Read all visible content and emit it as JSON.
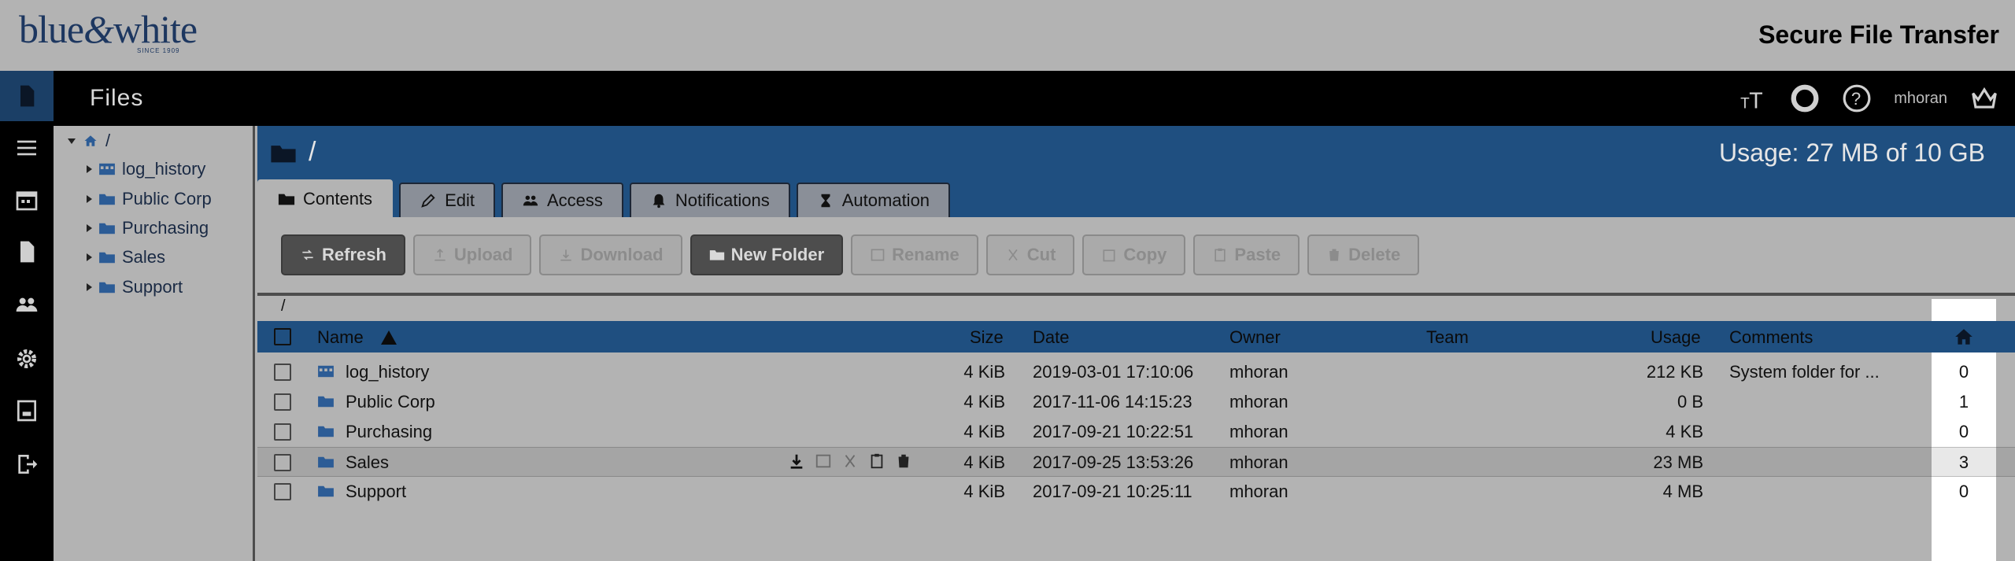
{
  "brand": {
    "logo_text_left": "blue",
    "logo_amp": "&",
    "logo_text_right": "white",
    "logo_since": "SINCE 1909",
    "app_title": "Secure File Transfer"
  },
  "rail": {
    "items": [
      {
        "icon": "files-icon",
        "active": true
      },
      {
        "icon": "menu-icon",
        "active": false
      },
      {
        "icon": "calendar-icon",
        "active": false
      },
      {
        "icon": "document-icon",
        "active": false
      },
      {
        "icon": "users-icon",
        "active": false
      },
      {
        "icon": "gear-icon",
        "active": false
      },
      {
        "icon": "report-icon",
        "active": false
      },
      {
        "icon": "logout-icon",
        "active": false
      }
    ]
  },
  "header": {
    "title": "Files",
    "username": "mhoran",
    "tools": [
      "text-size-icon",
      "help-ring-icon",
      "help-icon",
      "crown-icon"
    ]
  },
  "tree": {
    "root": "/",
    "items": [
      {
        "label": "log_history",
        "type": "system"
      },
      {
        "label": "Public Corp",
        "type": "folder"
      },
      {
        "label": "Purchasing",
        "type": "folder"
      },
      {
        "label": "Sales",
        "type": "folder"
      },
      {
        "label": "Support",
        "type": "folder"
      }
    ]
  },
  "main": {
    "path": "/",
    "usage": "Usage: 27 MB of 10 GB",
    "tabs": [
      {
        "label": "Contents",
        "active": true
      },
      {
        "label": "Edit",
        "active": false
      },
      {
        "label": "Access",
        "active": false
      },
      {
        "label": "Notifications",
        "active": false
      },
      {
        "label": "Automation",
        "active": false
      }
    ],
    "toolbar": [
      {
        "label": "Refresh",
        "enabled": true
      },
      {
        "label": "Upload",
        "enabled": false
      },
      {
        "label": "Download",
        "enabled": false
      },
      {
        "label": "New Folder",
        "enabled": true
      },
      {
        "label": "Rename",
        "enabled": false
      },
      {
        "label": "Cut",
        "enabled": false
      },
      {
        "label": "Copy",
        "enabled": false
      },
      {
        "label": "Paste",
        "enabled": false
      },
      {
        "label": "Delete",
        "enabled": false
      }
    ],
    "crumb": "/"
  },
  "table": {
    "headers": {
      "name": "Name",
      "size": "Size",
      "date": "Date",
      "owner": "Owner",
      "team": "Team",
      "usage": "Usage",
      "comments": "Comments"
    },
    "rows": [
      {
        "name": "log_history",
        "type": "system",
        "size": "4 KiB",
        "date": "2019-03-01 17:10:06",
        "owner": "mhoran",
        "team": "",
        "usage": "212 KB",
        "comments": "System folder for ...",
        "home": "0",
        "selected": false
      },
      {
        "name": "Public Corp",
        "type": "folder",
        "size": "4 KiB",
        "date": "2017-11-06 14:15:23",
        "owner": "mhoran",
        "team": "",
        "usage": "0 B",
        "comments": "",
        "home": "1",
        "selected": false
      },
      {
        "name": "Purchasing",
        "type": "folder",
        "size": "4 KiB",
        "date": "2017-09-21 10:22:51",
        "owner": "mhoran",
        "team": "",
        "usage": "4 KB",
        "comments": "",
        "home": "0",
        "selected": false
      },
      {
        "name": "Sales",
        "type": "folder",
        "size": "4 KiB",
        "date": "2017-09-25 13:53:26",
        "owner": "mhoran",
        "team": "",
        "usage": "23 MB",
        "comments": "",
        "home": "3",
        "selected": true
      },
      {
        "name": "Support",
        "type": "folder",
        "size": "4 KiB",
        "date": "2017-09-21 10:25:11",
        "owner": "mhoran",
        "team": "",
        "usage": "4 MB",
        "comments": "",
        "home": "0",
        "selected": false
      }
    ]
  },
  "colors": {
    "accent_blue": "#1f4f80",
    "background": "#b3b3b3",
    "rail": "#000000"
  }
}
